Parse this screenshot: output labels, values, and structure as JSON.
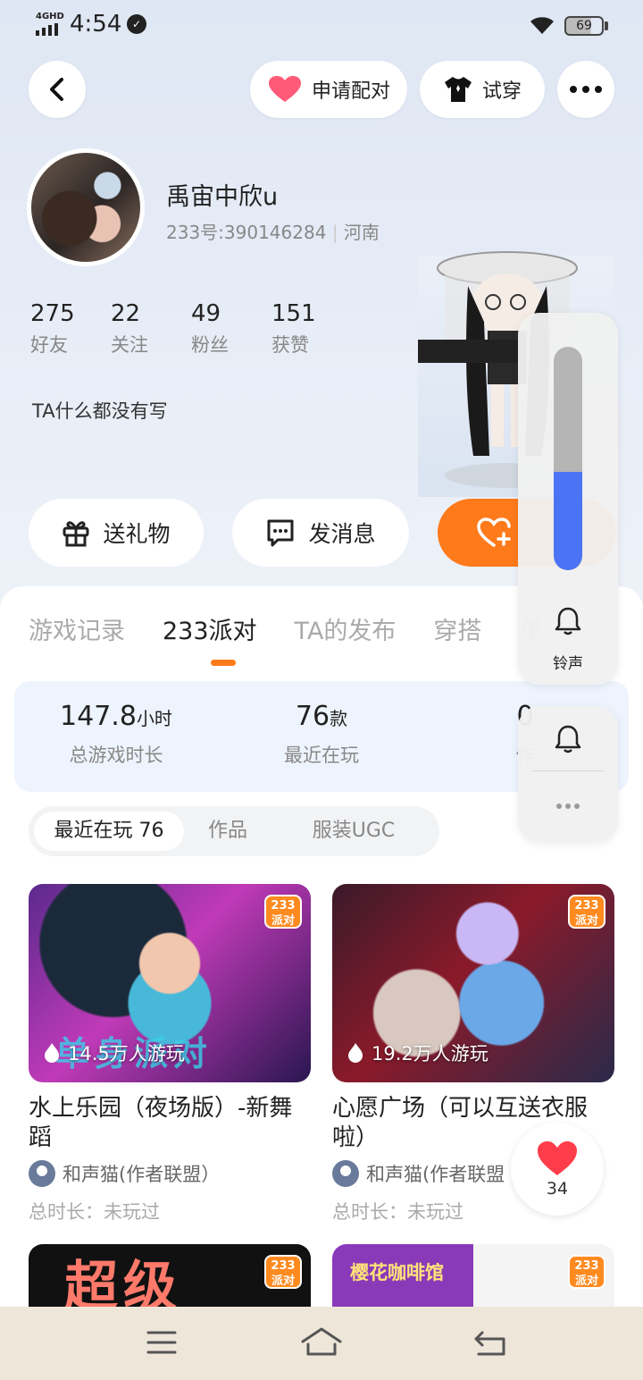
{
  "status_bar": {
    "network": "4GHD",
    "time": "4:54",
    "battery": "69"
  },
  "header": {
    "pair_label": "申请配对",
    "try_label": "试穿"
  },
  "profile": {
    "name": "禹宙中欣u",
    "id_text": "233号:390146284",
    "region": "河南",
    "stats": [
      {
        "value": "275",
        "label": "好友"
      },
      {
        "value": "22",
        "label": "关注"
      },
      {
        "value": "49",
        "label": "粉丝"
      },
      {
        "value": "151",
        "label": "获赞"
      }
    ],
    "bio": "TA什么都没有写"
  },
  "actions": {
    "gift": "送礼物",
    "message": "发消息"
  },
  "tabs": [
    "游戏记录",
    "233派对",
    "TA的发布",
    "穿搭",
    "单"
  ],
  "summary": {
    "total_time": "147.8",
    "total_time_unit": "小时",
    "total_time_label": "总游戏时长",
    "recent": "76",
    "recent_unit": "款",
    "recent_label": "最近在玩",
    "works": "0",
    "works_label": "作"
  },
  "subtabs": [
    "最近在玩 76",
    "作品",
    "服装UGC"
  ],
  "games": [
    {
      "title": "水上乐园（夜场版）-新舞蹈",
      "players": "14.5万人游玩",
      "author": "和声猫(作者联盟）",
      "time": "总时长：未玩过",
      "badge_top": "233",
      "badge_bottom": "派对",
      "overlay": "单身派对"
    },
    {
      "title": "心愿广场（可以互送衣服啦）",
      "players": "19.2万人游玩",
      "author": "和声猫(作者联盟",
      "time": "总时长：未玩过",
      "badge_top": "233",
      "badge_bottom": "派对"
    },
    {
      "overlay": "超级",
      "badge_top": "233",
      "badge_bottom": "派对"
    },
    {
      "overlay": "樱花咖啡馆",
      "badge_top": "233",
      "badge_bottom": "派对"
    }
  ],
  "like_count": "34",
  "volume": {
    "ringtone_label": "铃声",
    "level": 0.44
  },
  "colors": {
    "accent": "#ff7a1a",
    "volume": "#4b74f5",
    "badge": "#ff8a1f"
  }
}
